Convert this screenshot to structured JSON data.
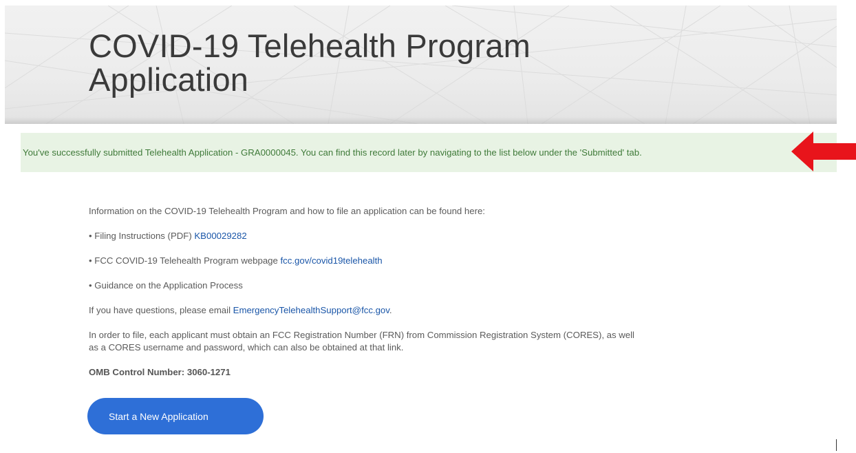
{
  "hero": {
    "title_line1": "COVID-19 Telehealth Program",
    "title_line2": "Application"
  },
  "alert": {
    "message": "You've successfully submitted Telehealth Application - GRA0000045. You can find this record later by navigating to the list below under the 'Submitted' tab.",
    "arrow_color": "#e8141b",
    "background_color": "#e8f3e4",
    "text_color": "#3f7a39"
  },
  "info": {
    "intro": "Information on the COVID-19 Telehealth Program and how to file an application can be found here:",
    "item1_prefix": "• Filing Instructions (PDF) ",
    "item1_link": "KB00029282",
    "item2_prefix": "• FCC COVID-19 Telehealth Program webpage ",
    "item2_link": "fcc.gov/covid19telehealth",
    "item3": "• Guidance on the Application Process",
    "questions_prefix": "If you have questions, please email ",
    "questions_email": "EmergencyTelehealthSupport@fcc.gov",
    "questions_suffix": ".",
    "frn_line1": "In order to file, each applicant must obtain an FCC Registration Number (FRN) from Commission Registration System (CORES), as well",
    "frn_line2": "as a CORES username and password, which can also be obtained at that link.",
    "omb": "OMB Control Number: 3060-1271"
  },
  "button": {
    "label": "Start a New Application",
    "color": "#2e6fd7"
  },
  "colors": {
    "link": "#1a56a8"
  }
}
